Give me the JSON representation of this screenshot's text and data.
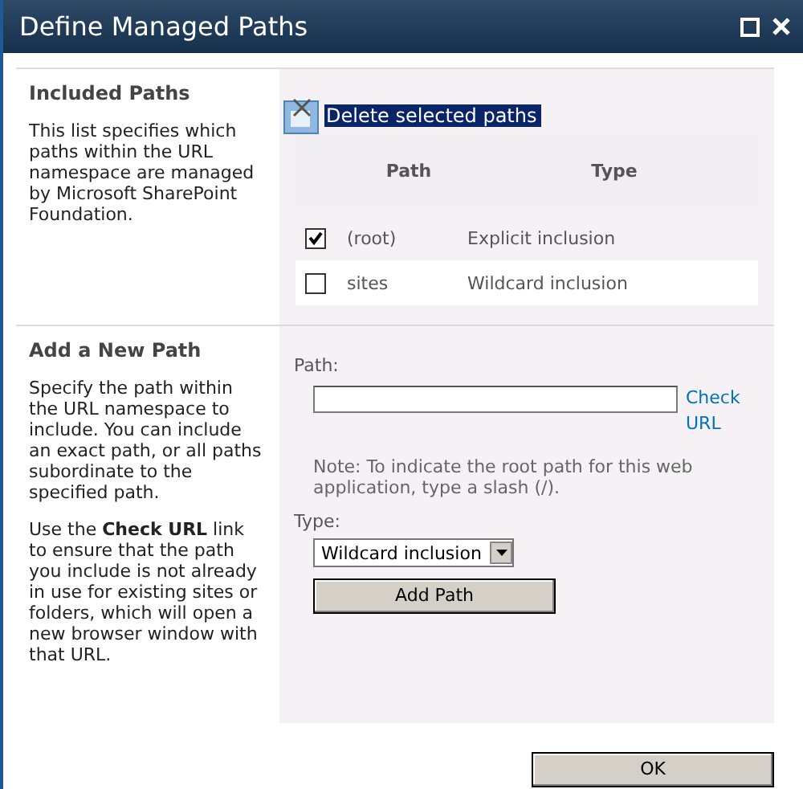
{
  "window": {
    "title": "Define Managed Paths"
  },
  "included_paths": {
    "heading": "Included Paths",
    "description": "This list specifies which paths within the URL namespace are managed by Microsoft SharePoint Foundation.",
    "delete_link": {
      "label": "Delete selected paths",
      "highlighted": true
    },
    "columns": [
      "Path",
      "Type"
    ],
    "rows": [
      {
        "path": "(root)",
        "type": "Explicit inclusion",
        "checked": true
      },
      {
        "path": "sites",
        "type": "Wildcard inclusion",
        "checked": false
      }
    ]
  },
  "add_path": {
    "heading": "Add a New Path",
    "description": "Specify the path within the URL namespace to include. You can include an exact path, or all paths subordinate to the specified path.",
    "description_2": "Use the **Check URL** link to ensure that the path you include is not already in use for existing sites or folders, which will open a new browser window with that URL.",
    "path_label": "Path:",
    "check_link": "Check URL",
    "note": "Note: To indicate the root path for this web application, type a slash (/).",
    "type_label": "Type:",
    "type_value": "Wildcard inclusion",
    "add_button": "Add Path"
  },
  "buttons": [
    "OK"
  ]
}
